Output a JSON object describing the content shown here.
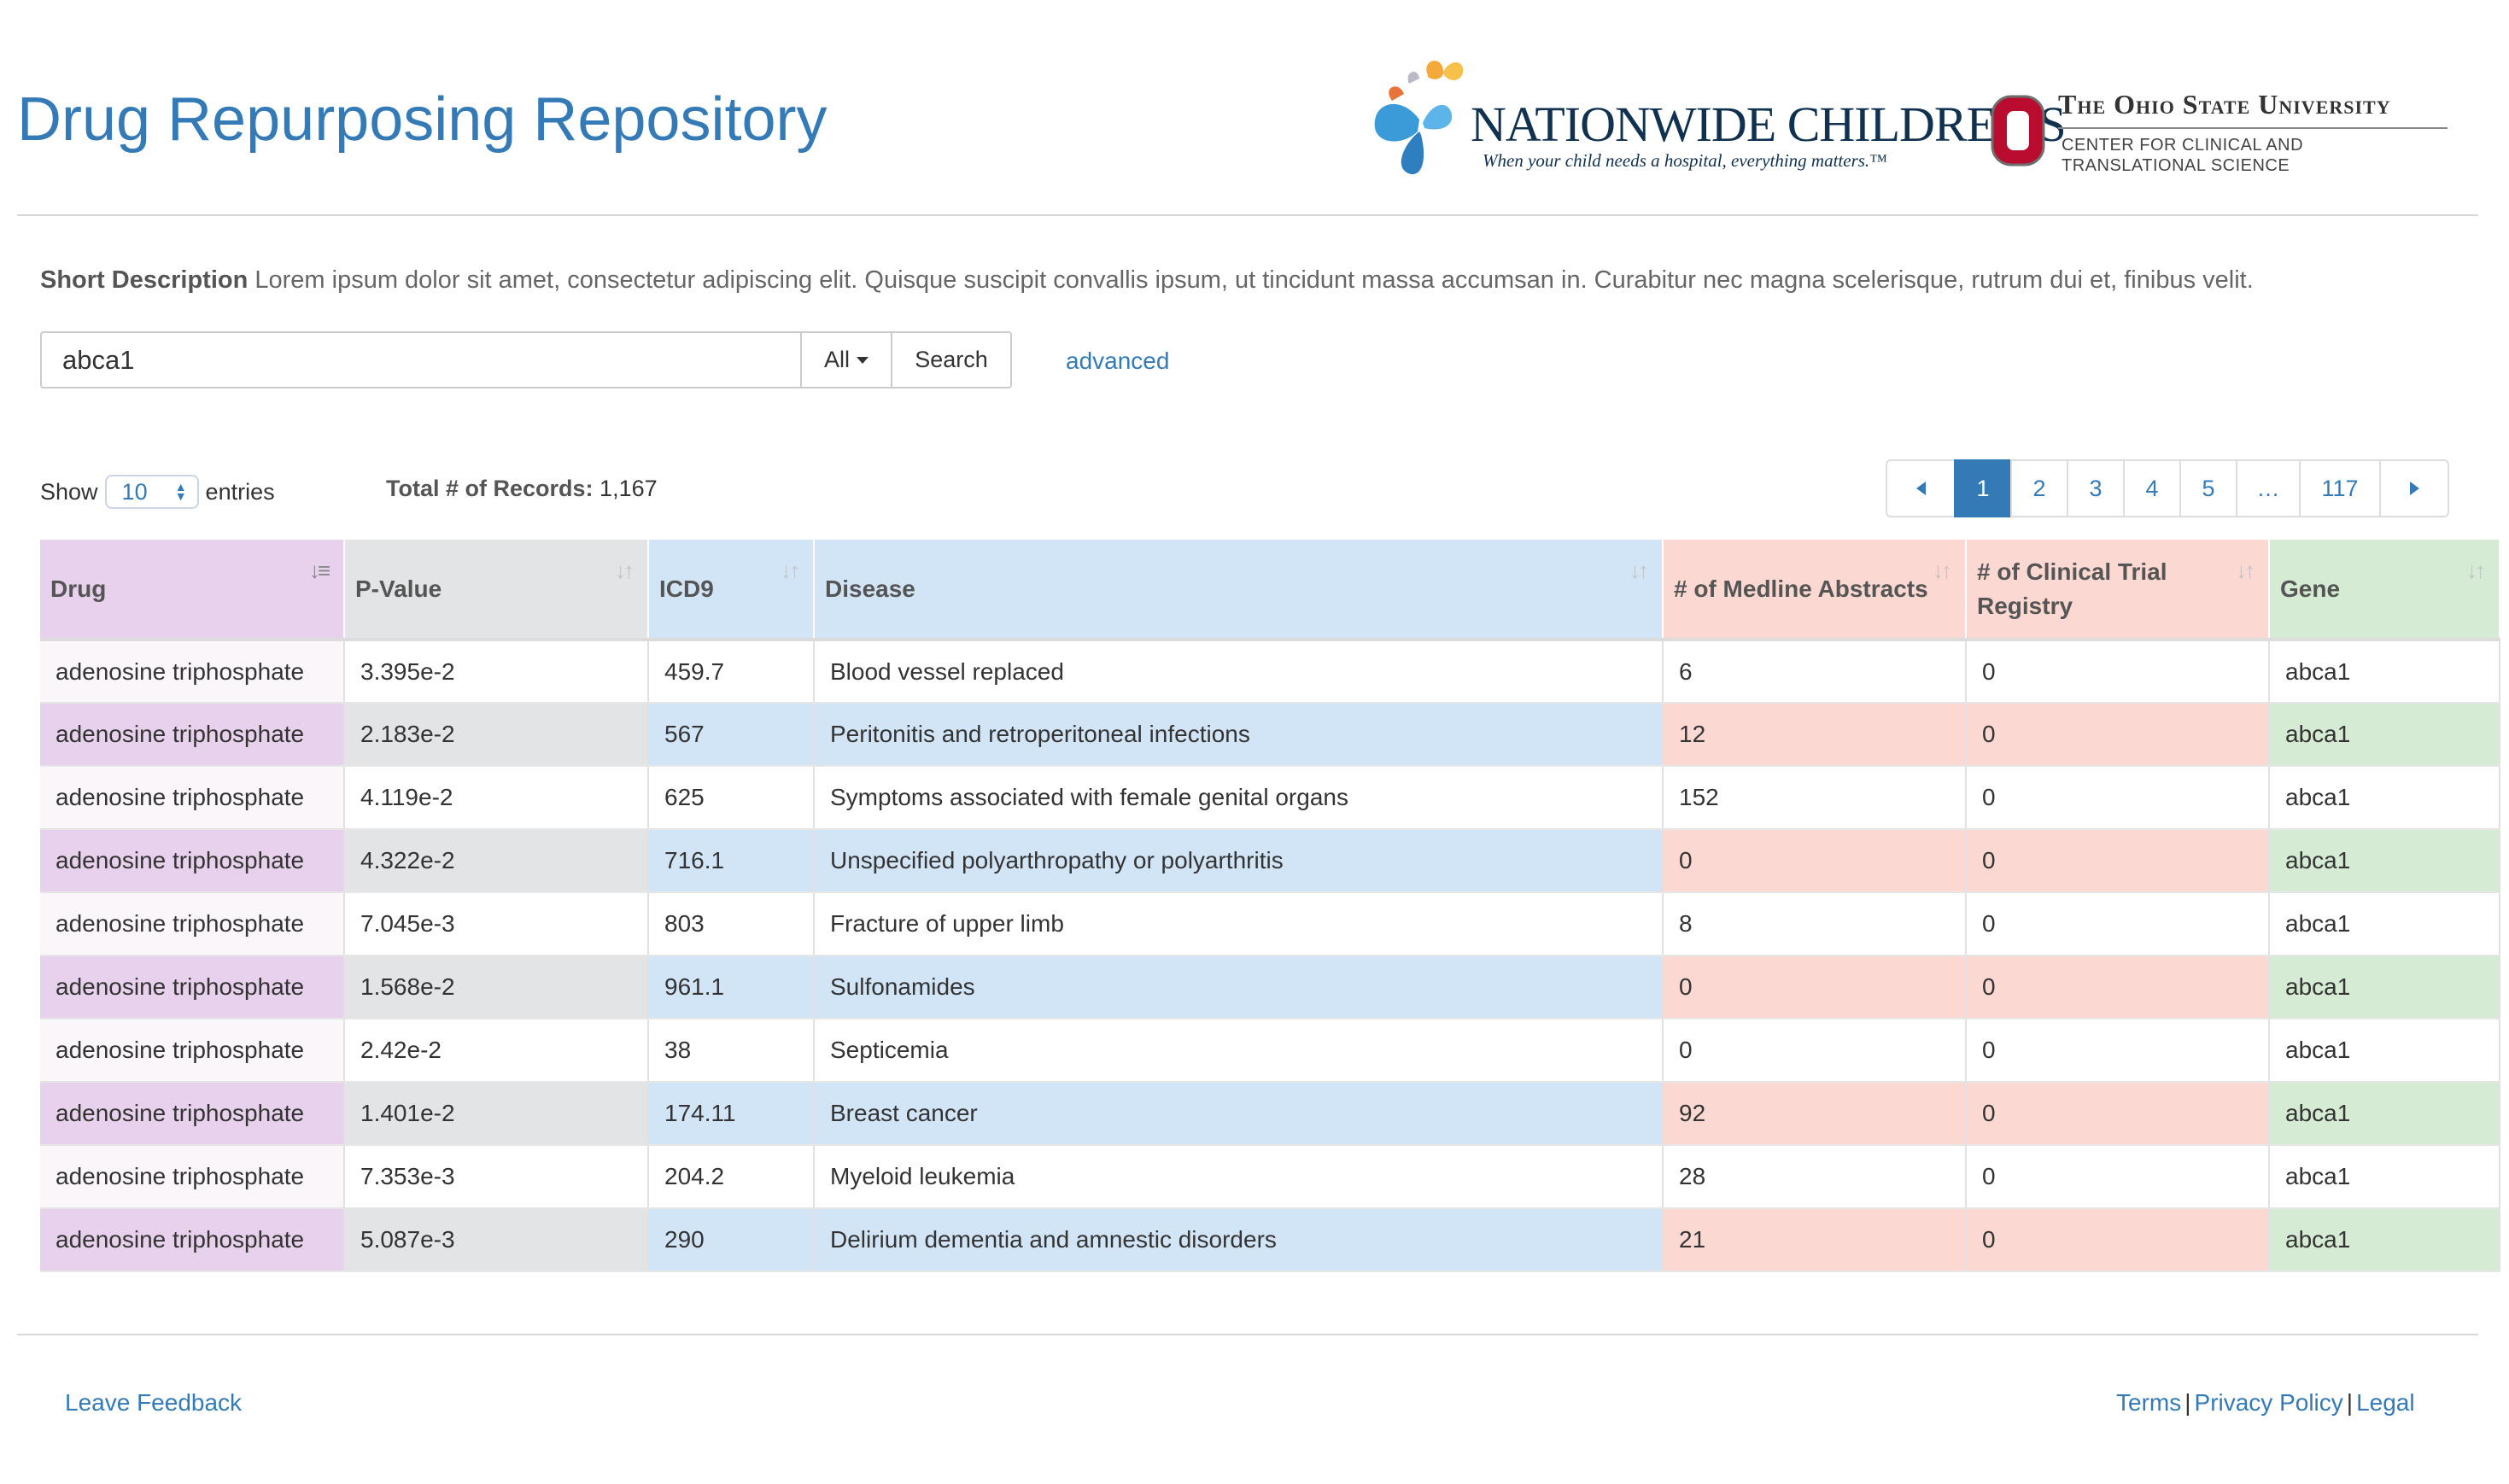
{
  "app": {
    "title": "Drug Repurposing Repository"
  },
  "logos": {
    "nationwide": {
      "name": "NATIONWIDE CHILDREN'S",
      "tagline": "When your child needs a hospital, everything matters.™"
    },
    "osu": {
      "name": "The Ohio State University",
      "sub1": "CENTER FOR CLINICAL AND",
      "sub2": "TRANSLATIONAL SCIENCE",
      "accent": "#ba0c2f"
    }
  },
  "description": {
    "label": "Short Description",
    "text": "Lorem ipsum dolor sit amet, consectetur adipiscing elit. Quisque suscipit convallis ipsum, ut tincidunt massa accumsan in. Curabitur nec magna scelerisque, rutrum dui et, finibus velit."
  },
  "search": {
    "value": "abca1",
    "scope": "All",
    "button": "Search",
    "advanced": "advanced"
  },
  "table_controls": {
    "show_label": "Show",
    "page_length": "10",
    "entries_label": "entries",
    "total_label": "Total # of Records:",
    "total_value": "1,167"
  },
  "pagination": {
    "pages": [
      "1",
      "2",
      "3",
      "4",
      "5",
      "…",
      "117"
    ],
    "active": "1"
  },
  "table": {
    "columns": [
      "Drug",
      "P-Value",
      "ICD9",
      "Disease",
      "# of Medline Abstracts",
      "# of Clinical Trial Registry",
      "Gene"
    ],
    "sorted_column": "Drug",
    "rows": [
      [
        "adenosine triphosphate",
        "3.395e-2",
        "459.7",
        "Blood vessel replaced",
        "6",
        "0",
        "abca1"
      ],
      [
        "adenosine triphosphate",
        "2.183e-2",
        "567",
        "Peritonitis and retroperitoneal infections",
        "12",
        "0",
        "abca1"
      ],
      [
        "adenosine triphosphate",
        "4.119e-2",
        "625",
        "Symptoms associated with female genital organs",
        "152",
        "0",
        "abca1"
      ],
      [
        "adenosine triphosphate",
        "4.322e-2",
        "716.1",
        "Unspecified polyarthropathy or polyarthritis",
        "0",
        "0",
        "abca1"
      ],
      [
        "adenosine triphosphate",
        "7.045e-3",
        "803",
        "Fracture of upper limb",
        "8",
        "0",
        "abca1"
      ],
      [
        "adenosine triphosphate",
        "1.568e-2",
        "961.1",
        "Sulfonamides",
        "0",
        "0",
        "abca1"
      ],
      [
        "adenosine triphosphate",
        "2.42e-2",
        "38",
        "Septicemia",
        "0",
        "0",
        "abca1"
      ],
      [
        "adenosine triphosphate",
        "1.401e-2",
        "174.11",
        "Breast cancer",
        "92",
        "0",
        "abca1"
      ],
      [
        "adenosine triphosphate",
        "7.353e-3",
        "204.2",
        "Myeloid leukemia",
        "28",
        "0",
        "abca1"
      ],
      [
        "adenosine triphosphate",
        "5.087e-3",
        "290",
        "Delirium dementia and amnestic disorders",
        "21",
        "0",
        "abca1"
      ]
    ]
  },
  "footer": {
    "feedback": "Leave Feedback",
    "terms": "Terms",
    "privacy": "Privacy Policy",
    "legal": "Legal",
    "separator": "|"
  },
  "colors": {
    "link": "#337ab7",
    "drug_col": "#e8d1ec",
    "pvalue_col": "#e2e4e6",
    "icd9_disease_col": "#d2e5f7",
    "counts_col": "#fbd8d1",
    "gene_col": "#d6ebd3"
  }
}
